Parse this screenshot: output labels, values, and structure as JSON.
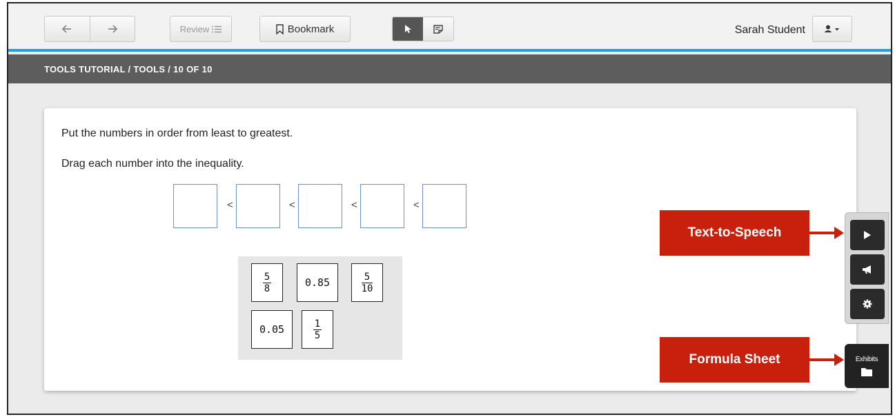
{
  "toolbar": {
    "back_icon": "arrow-left-icon",
    "forward_icon": "arrow-right-icon",
    "review_label": "Review",
    "bookmark_label": "Bookmark",
    "pointer_icon": "pointer-icon",
    "note_icon": "sticky-note-icon",
    "user_name": "Sarah Student",
    "user_icon": "user-dropdown-icon"
  },
  "breadcrumb": {
    "text": "TOOLS TUTORIAL / TOOLS / 10 OF 10"
  },
  "question": {
    "prompt1": "Put the numbers in order from least to greatest.",
    "prompt2": "Drag each number into the inequality.",
    "inequality_symbol": "<",
    "slot_count": 5
  },
  "tiles": [
    {
      "type": "fraction",
      "num": "5",
      "den": "8"
    },
    {
      "type": "decimal",
      "value": "0.85"
    },
    {
      "type": "fraction",
      "num": "5",
      "den": "10"
    },
    {
      "type": "decimal",
      "value": "0.05"
    },
    {
      "type": "fraction",
      "num": "1",
      "den": "5"
    }
  ],
  "callouts": {
    "tts": "Text-to-Speech",
    "formula": "Formula Sheet"
  },
  "side_tools": {
    "play_icon": "play-icon",
    "megaphone_icon": "megaphone-icon",
    "settings_icon": "gear-icon",
    "exhibits_label": "Exhibits",
    "folder_icon": "folder-icon"
  },
  "colors": {
    "accent": "#2a9ad8",
    "callout": "#c8200d",
    "crumb_bg": "#5d5d5d"
  }
}
